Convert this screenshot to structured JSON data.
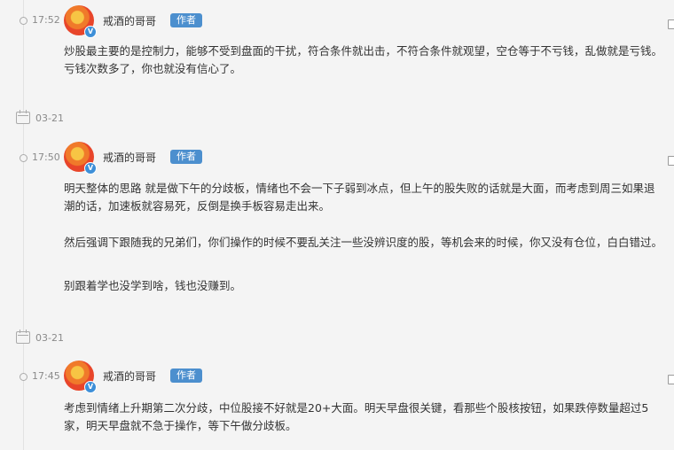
{
  "posts": [
    {
      "time": "17:52",
      "author": "戒酒的哥哥",
      "tag": "作者",
      "paragraphs": [
        "炒股最主要的是控制力，能够不受到盘面的干扰，符合条件就出击，不符合条件就观望，空仓等于不亏钱，乱做就是亏钱。亏钱次数多了，你也就没有信心了。"
      ]
    },
    {
      "date": "03-21",
      "time": "17:50",
      "author": "戒酒的哥哥",
      "tag": "作者",
      "paragraphs": [
        "明天整体的思路 就是做下午的分歧板，情绪也不会一下子弱到冰点，但上午的股失败的话就是大面，而考虑到周三如果退潮的话，加速板就容易死，反倒是换手板容易走出来。",
        "然后强调下跟随我的兄弟们，你们操作的时候不要乱关注一些没辨识度的股，等机会来的时候，你又没有仓位，白白错过。",
        "别跟着学也没学到啥，钱也没赚到。"
      ]
    },
    {
      "date": "03-21",
      "time": "17:45",
      "author": "戒酒的哥哥",
      "tag": "作者",
      "paragraphs": [
        "考虑到情绪上升期第二次分歧，中位股接不好就是20+大面。明天早盘很关键，看那些个股核按钮，如果跌停数量超过5家，明天早盘就不急于操作，等下午做分歧板。"
      ]
    }
  ],
  "icons": {
    "avatar_badge": "V"
  }
}
